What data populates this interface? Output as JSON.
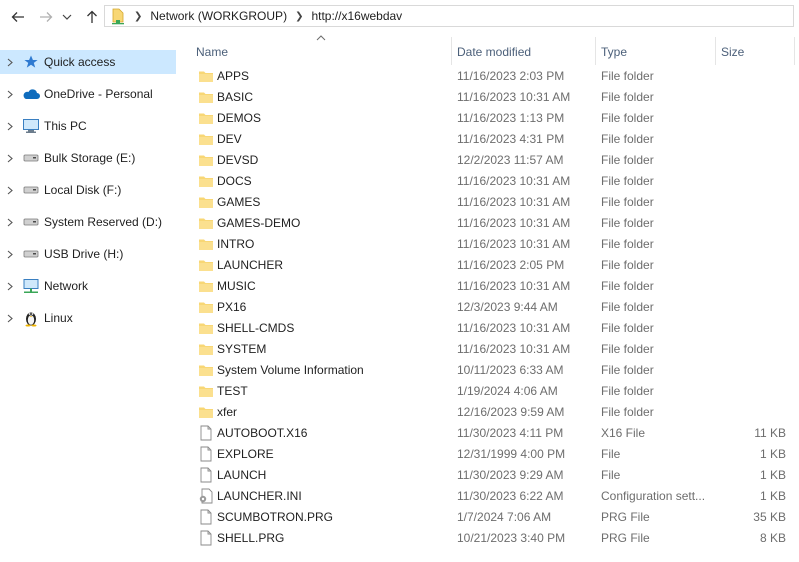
{
  "colors": {
    "selection": "#cce8ff",
    "folder": "#f8d775",
    "header_text": "#4c607a",
    "meta_text": "#6d6d6d"
  },
  "toolbar": {
    "back_icon": "arrow-left-icon",
    "forward_icon": "arrow-right-icon",
    "recent_icon": "chevron-down-icon",
    "up_icon": "arrow-up-icon"
  },
  "address": {
    "location_icon": "network-folder-icon",
    "crumbs": [
      "Network (WORKGROUP)",
      "http://x16webdav"
    ]
  },
  "sidebar": {
    "items": [
      {
        "label": "Quick access",
        "icon": "star-icon"
      },
      {
        "label": "OneDrive - Personal",
        "icon": "cloud-icon"
      },
      {
        "label": "This PC",
        "icon": "monitor-icon"
      },
      {
        "label": "Bulk Storage (E:)",
        "icon": "drive-icon"
      },
      {
        "label": "Local Disk (F:)",
        "icon": "drive-icon"
      },
      {
        "label": "System Reserved (D:)",
        "icon": "drive-icon"
      },
      {
        "label": "USB Drive (H:)",
        "icon": "drive-icon"
      },
      {
        "label": "Network",
        "icon": "network-icon"
      },
      {
        "label": "Linux",
        "icon": "penguin-icon"
      }
    ]
  },
  "columns": {
    "name": "Name",
    "date": "Date modified",
    "type": "Type",
    "size": "Size"
  },
  "files": [
    {
      "name": "APPS",
      "date": "11/16/2023 2:03 PM",
      "type": "File folder",
      "size": "",
      "kind": "folder"
    },
    {
      "name": "BASIC",
      "date": "11/16/2023 10:31 AM",
      "type": "File folder",
      "size": "",
      "kind": "folder"
    },
    {
      "name": "DEMOS",
      "date": "11/16/2023 1:13 PM",
      "type": "File folder",
      "size": "",
      "kind": "folder"
    },
    {
      "name": "DEV",
      "date": "11/16/2023 4:31 PM",
      "type": "File folder",
      "size": "",
      "kind": "folder"
    },
    {
      "name": "DEVSD",
      "date": "12/2/2023 11:57 AM",
      "type": "File folder",
      "size": "",
      "kind": "folder"
    },
    {
      "name": "DOCS",
      "date": "11/16/2023 10:31 AM",
      "type": "File folder",
      "size": "",
      "kind": "folder"
    },
    {
      "name": "GAMES",
      "date": "11/16/2023 10:31 AM",
      "type": "File folder",
      "size": "",
      "kind": "folder"
    },
    {
      "name": "GAMES-DEMO",
      "date": "11/16/2023 10:31 AM",
      "type": "File folder",
      "size": "",
      "kind": "folder"
    },
    {
      "name": "INTRO",
      "date": "11/16/2023 10:31 AM",
      "type": "File folder",
      "size": "",
      "kind": "folder"
    },
    {
      "name": "LAUNCHER",
      "date": "11/16/2023 2:05 PM",
      "type": "File folder",
      "size": "",
      "kind": "folder"
    },
    {
      "name": "MUSIC",
      "date": "11/16/2023 10:31 AM",
      "type": "File folder",
      "size": "",
      "kind": "folder"
    },
    {
      "name": "PX16",
      "date": "12/3/2023 9:44 AM",
      "type": "File folder",
      "size": "",
      "kind": "folder"
    },
    {
      "name": "SHELL-CMDS",
      "date": "11/16/2023 10:31 AM",
      "type": "File folder",
      "size": "",
      "kind": "folder"
    },
    {
      "name": "SYSTEM",
      "date": "11/16/2023 10:31 AM",
      "type": "File folder",
      "size": "",
      "kind": "folder"
    },
    {
      "name": "System Volume Information",
      "date": "10/11/2023 6:33 AM",
      "type": "File folder",
      "size": "",
      "kind": "folder"
    },
    {
      "name": "TEST",
      "date": "1/19/2024 4:06 AM",
      "type": "File folder",
      "size": "",
      "kind": "folder"
    },
    {
      "name": "xfer",
      "date": "12/16/2023 9:59 AM",
      "type": "File folder",
      "size": "",
      "kind": "folder"
    },
    {
      "name": "AUTOBOOT.X16",
      "date": "11/30/2023 4:11 PM",
      "type": "X16 File",
      "size": "11 KB",
      "kind": "file"
    },
    {
      "name": "EXPLORE",
      "date": "12/31/1999 4:00 PM",
      "type": "File",
      "size": "1 KB",
      "kind": "file"
    },
    {
      "name": "LAUNCH",
      "date": "11/30/2023 9:29 AM",
      "type": "File",
      "size": "1 KB",
      "kind": "file"
    },
    {
      "name": "LAUNCHER.INI",
      "date": "11/30/2023 6:22 AM",
      "type": "Configuration sett...",
      "size": "1 KB",
      "kind": "config"
    },
    {
      "name": "SCUMBOTRON.PRG",
      "date": "1/7/2024 7:06 AM",
      "type": "PRG File",
      "size": "35 KB",
      "kind": "file"
    },
    {
      "name": "SHELL.PRG",
      "date": "10/21/2023 3:40 PM",
      "type": "PRG File",
      "size": "8 KB",
      "kind": "file"
    }
  ]
}
